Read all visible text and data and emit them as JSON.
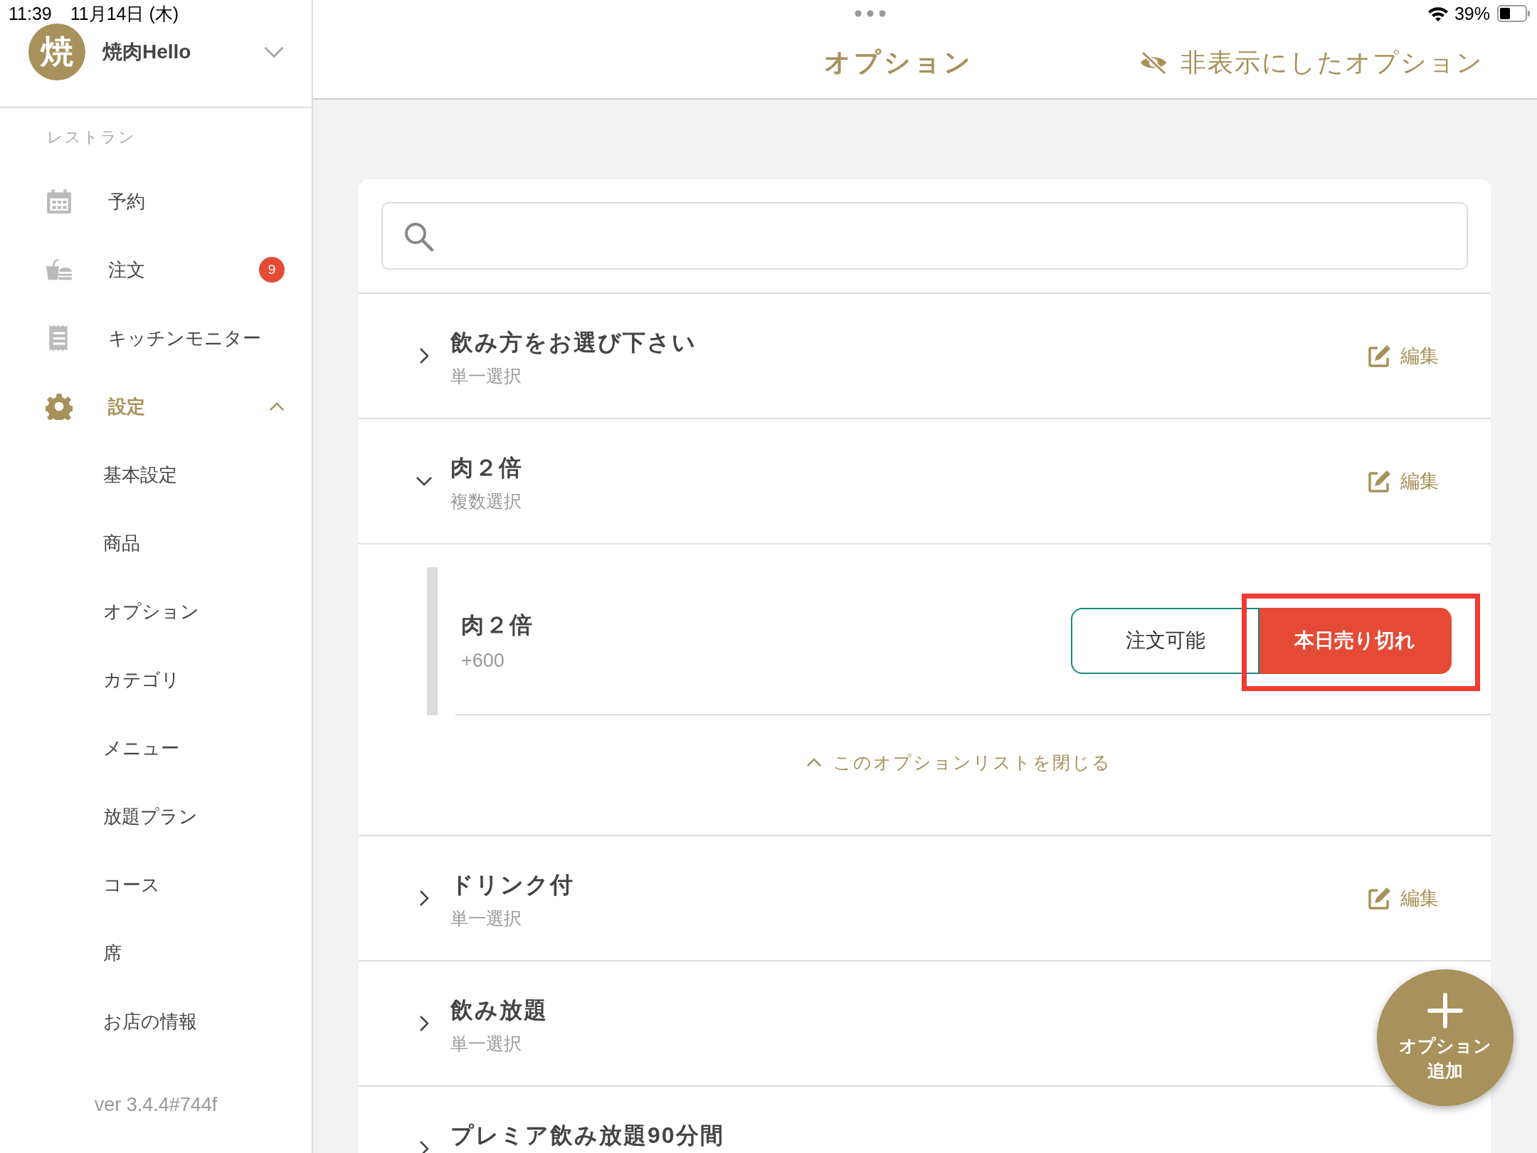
{
  "status_bar": {
    "time": "11:39",
    "date": "11月14日 (木)",
    "battery": "39%"
  },
  "sidebar": {
    "avatar": "焼",
    "shop_name": "焼肉Hello",
    "section": "レストラン",
    "items": [
      {
        "kind": "calendar",
        "label": "予約",
        "selected": false
      },
      {
        "kind": "food",
        "label": "注文",
        "badge": "9",
        "selected": false
      },
      {
        "kind": "receipt",
        "label": "キッチンモニター",
        "selected": false
      },
      {
        "kind": "gear",
        "label": "設定",
        "selected": true,
        "expanded": true,
        "children": [
          {
            "label": "基本設定",
            "selected": false
          },
          {
            "label": "商品",
            "selected": false
          },
          {
            "label": "オプション",
            "selected": false
          },
          {
            "label": "カテゴリ",
            "selected": false
          },
          {
            "label": "メニュー",
            "selected": false
          },
          {
            "label": "放題プラン",
            "selected": false
          },
          {
            "label": "コース",
            "selected": false
          },
          {
            "label": "席",
            "selected": false
          },
          {
            "label": "お店の情報",
            "selected": false
          }
        ]
      }
    ],
    "version": "ver 3.4.4#744f"
  },
  "header": {
    "title": "オプション",
    "hidden_link": "非表示にしたオプション"
  },
  "options": [
    {
      "title": "飲み方をお選び下さい",
      "type": "単一選択",
      "expanded": false,
      "edit": "編集"
    },
    {
      "title": "肉２倍",
      "type": "複数選択",
      "expanded": true,
      "edit": "編集",
      "items": [
        {
          "name": "肉２倍",
          "price": "+600",
          "states": [
            {
              "label": "注文可能",
              "selected": false,
              "highlighted": false
            },
            {
              "label": "本日売り切れ",
              "selected": true,
              "highlighted": true
            }
          ]
        }
      ],
      "collapse": "このオプションリストを閉じる"
    },
    {
      "title": "ドリンク付",
      "type": "単一選択",
      "expanded": false,
      "edit": "編集"
    },
    {
      "title": "飲み放題",
      "type": "単一選択",
      "expanded": false
    },
    {
      "title": "プレミア飲み放題90分間",
      "expanded": false
    }
  ],
  "fab": {
    "lines": [
      "オプション",
      "追加"
    ]
  }
}
